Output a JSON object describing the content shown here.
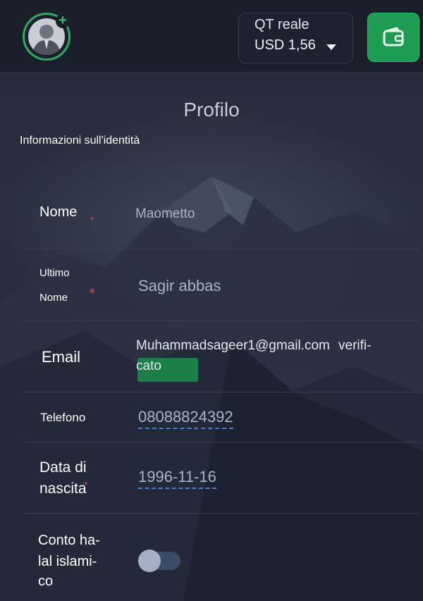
{
  "header": {
    "account_type": "QT reale",
    "balance": "USD 1,56",
    "icons": [
      "avatar-icon",
      "plus-icon",
      "chevron-down-icon",
      "wallet-icon"
    ]
  },
  "page": {
    "title": "Profilo",
    "section_heading": "Informazioni sull'identità"
  },
  "fields": {
    "first_name": {
      "label": "Nome",
      "value": "Maometto"
    },
    "last_name": {
      "label_line1": "Ultimo",
      "label_line2": "Nome",
      "value": "Sagir abbas"
    },
    "email": {
      "label": "Email",
      "value": "Muhammadsageer1@gmail.com",
      "status": "verificato"
    },
    "phone": {
      "label": "Telefono",
      "value": "08088824392"
    },
    "birth_date": {
      "label_line1": "Data di",
      "label_line2": "nascita",
      "value": "1996-11-16"
    },
    "islamic_account": {
      "label_line1": "Conto ha-",
      "label_line2": "lal islami-",
      "label_line3": "co",
      "enabled": false
    }
  },
  "required_marker": "*",
  "colors": {
    "accent_green": "#1e9c55",
    "required_red": "#d64848",
    "link_underline": "#4a7fc8"
  }
}
